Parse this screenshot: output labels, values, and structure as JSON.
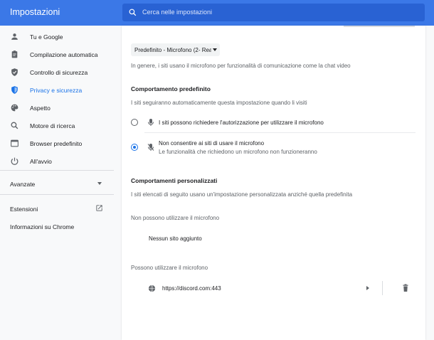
{
  "header": {
    "title": "Impostazioni",
    "search_placeholder": "Cerca nelle impostazioni"
  },
  "sidebar": {
    "items": [
      {
        "label": "Tu e Google",
        "icon": "person-icon"
      },
      {
        "label": "Compilazione automatica",
        "icon": "clipboard-icon"
      },
      {
        "label": "Controllo di sicurezza",
        "icon": "shield-check-icon"
      },
      {
        "label": "Privacy e sicurezza",
        "icon": "shield-icon",
        "active": true
      },
      {
        "label": "Aspetto",
        "icon": "palette-icon"
      },
      {
        "label": "Motore di ricerca",
        "icon": "search-icon"
      },
      {
        "label": "Browser predefinito",
        "icon": "browser-icon"
      },
      {
        "label": "All'avvio",
        "icon": "power-icon"
      }
    ],
    "advanced_label": "Avanzate",
    "extensions_label": "Estensioni",
    "about_label": "Informazioni su Chrome"
  },
  "main": {
    "device_select": "Predefinito - Microfono (2- Realtek",
    "device_hint": "In genere, i siti usano il microfono per funzionalità di comunicazione come la chat video",
    "default_behavior": {
      "title": "Comportamento predefinito",
      "description": "I siti seguiranno automaticamente questa impostazione quando li visiti",
      "options": [
        {
          "label": "I siti possono richiedere l'autorizzazione per utilizzare il microfono",
          "checked": false
        },
        {
          "label": "Non consentire ai siti di usare il microfono",
          "sublabel": "Le funzionalità che richiedono un microfono non funzioneranno",
          "checked": true
        }
      ]
    },
    "custom_behavior": {
      "title": "Comportamenti personalizzati",
      "description": "I siti elencati di seguito usano un'impostazione personalizzata anziché quella predefinita",
      "blocked_title": "Non possono utilizzare il microfono",
      "blocked_empty": "Nessun sito aggiunto",
      "allowed_title": "Possono utilizzare il microfono",
      "allowed_sites": [
        "https://discord.com:443"
      ]
    }
  },
  "colors": {
    "accent": "#1a73e8",
    "header_bg": "#3b78e7",
    "search_bg": "#2962d3"
  }
}
